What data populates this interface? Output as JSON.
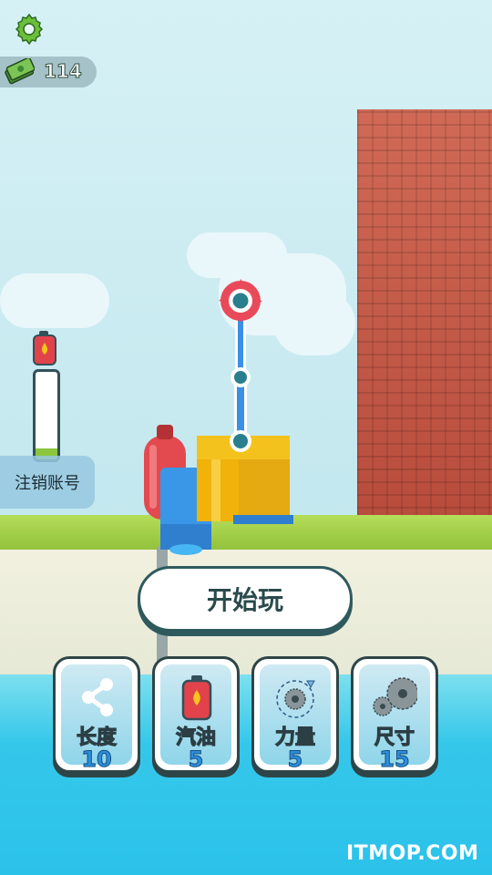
{
  "hud": {
    "cash_value": "114",
    "fuel_level": 0.12,
    "logout_label": "注销账号"
  },
  "start_button": {
    "label": "开始玩"
  },
  "upgrades": [
    {
      "label": "长度",
      "value": "10",
      "icon": "share-nodes-icon"
    },
    {
      "label": "汽油",
      "value": "5",
      "icon": "fuel-can-icon"
    },
    {
      "label": "力量",
      "value": "5",
      "icon": "saw-rotate-icon"
    },
    {
      "label": "尺寸",
      "value": "15",
      "icon": "saw-blades-icon"
    }
  ],
  "watermark": "ITMOP.COM",
  "colors": {
    "wall": "#c45a48",
    "arm": "#3a8fe6",
    "joint": "#2a7f8e",
    "saw": "#e94a5a",
    "cube": "#f4c21c",
    "fuel": "#8cc63e"
  }
}
